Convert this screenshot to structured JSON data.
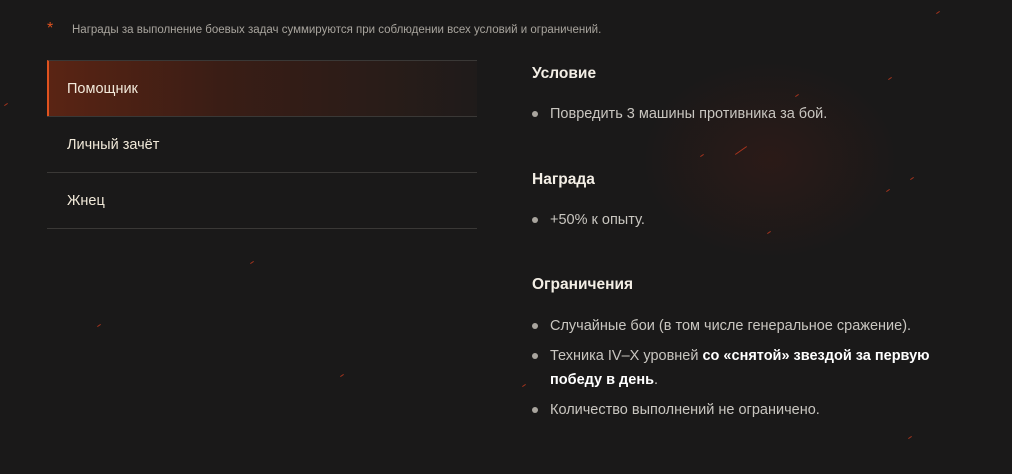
{
  "notice": {
    "marker": "*",
    "text": "Награды за выполнение боевых задач суммируются при соблюдении всех условий и ограничений."
  },
  "tabs": [
    {
      "label": "Помощник",
      "active": true
    },
    {
      "label": "Личный зачёт",
      "active": false
    },
    {
      "label": "Жнец",
      "active": false
    }
  ],
  "condition": {
    "title": "Условие",
    "items": [
      "Повредить 3 машины противника за бой."
    ]
  },
  "reward": {
    "title": "Награда",
    "items": [
      "+50% к опыту."
    ]
  },
  "limits": {
    "title": "Ограничения",
    "item1": "Случайные бои (в том числе генеральное сражение).",
    "item2_prefix": "Техника IV–X уровней ",
    "item2_bold": "со «снятой» звездой за первую победу в день",
    "item2_suffix": ".",
    "item3": "Количество выполнений не ограничено."
  },
  "colors": {
    "background": "#1a1919",
    "accent": "#e0531f",
    "active_tab_gradient_start": "#5a2414",
    "title_text": "#f3eee5",
    "body_text": "#c9c6c0"
  }
}
